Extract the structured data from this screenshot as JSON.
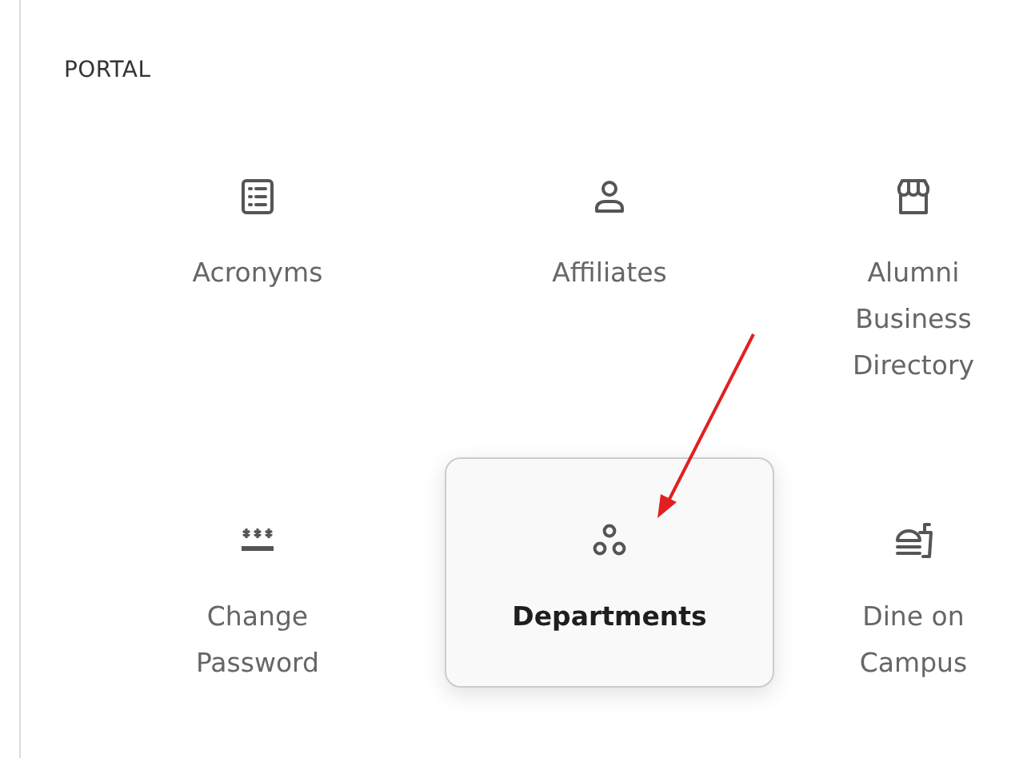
{
  "section_title": "PORTAL",
  "tiles": [
    {
      "label": "Acronyms",
      "selected": false
    },
    {
      "label": "Affiliates",
      "selected": false
    },
    {
      "label": "Alumni Business Directory",
      "selected": false
    },
    {
      "label": "Change Password",
      "selected": false
    },
    {
      "label": "Departments",
      "selected": true
    },
    {
      "label": "Dine on Campus",
      "selected": false
    }
  ]
}
